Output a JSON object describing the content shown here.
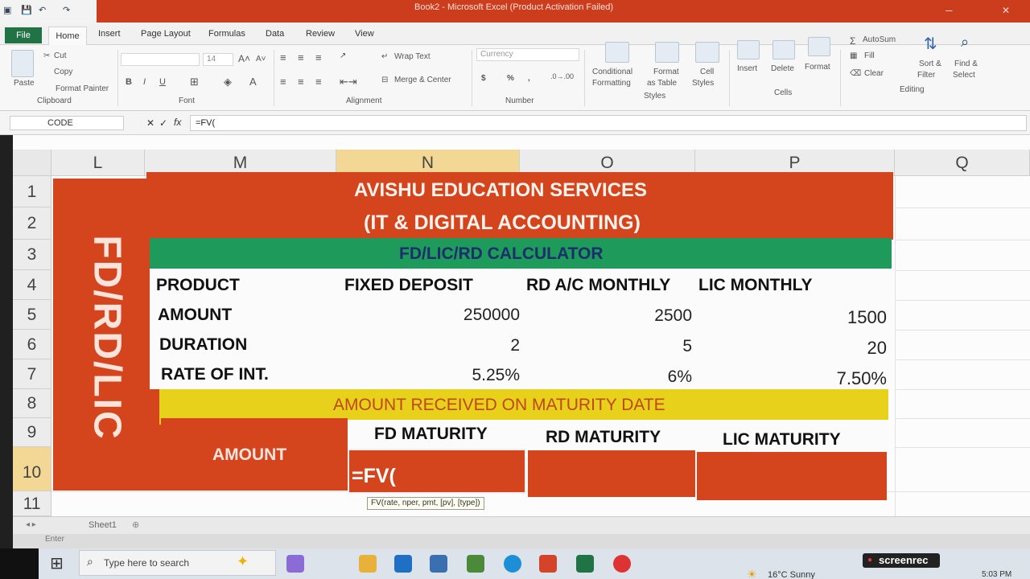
{
  "window": {
    "title": "Book2 - Microsoft Excel (Product Activation Failed)"
  },
  "ribbon": {
    "tabs": [
      "File",
      "Home",
      "Insert",
      "Page Layout",
      "Formulas",
      "Data",
      "Review",
      "View"
    ],
    "clipboard": {
      "cut": "Cut",
      "copy": "Copy",
      "paste": "Paste",
      "format_painter": "Format Painter",
      "group": "Clipboard"
    },
    "font": {
      "size": "14",
      "group": "Font"
    },
    "alignment": {
      "wrap_text": "Wrap Text",
      "merge_center": "Merge & Center",
      "group": "Alignment"
    },
    "number": {
      "format": "Currency",
      "group": "Number"
    },
    "styles": {
      "conditional": "Conditional",
      "formatting": "Formatting",
      "format_as": "Format",
      "as_table": "as Table",
      "cell": "Cell",
      "cell_styles": "Styles",
      "group": "Styles"
    },
    "cells": {
      "insert": "Insert",
      "delete": "Delete",
      "format": "Format",
      "group": "Cells"
    },
    "editing": {
      "autosum": "AutoSum",
      "fill": "Fill",
      "clear": "Clear",
      "sort": "Sort &",
      "filter": "Filter",
      "find": "Find &",
      "select": "Select",
      "group": "Editing"
    }
  },
  "formula_bar": {
    "name_box": "CODE",
    "formula": "=FV("
  },
  "columns": [
    "L",
    "M",
    "N",
    "O",
    "P",
    "Q"
  ],
  "rows": [
    "1",
    "2",
    "3",
    "4",
    "5",
    "6",
    "7",
    "8",
    "9",
    "10",
    "11"
  ],
  "sheet": {
    "side_label": "FD/RD/LIC",
    "header1": "AVISHU EDUCATION SERVICES",
    "header2": "(IT & DIGITAL ACCOUNTING)",
    "calc_title": "FD/LIC/RD CALCULATOR",
    "product_label": "PRODUCT",
    "product_fd": "FIXED DEPOSIT",
    "product_rd": "RD A/C MONTHLY",
    "product_lic": "LIC MONTHLY",
    "amount_label": "AMOUNT",
    "amount_fd": "250000",
    "amount_rd": "2500",
    "amount_lic": "1500",
    "duration_label": "DURATION",
    "duration_fd": "2",
    "duration_rd": "5",
    "duration_lic": "20",
    "rate_label": "RATE OF INT.",
    "rate_fd": "5.25%",
    "rate_rd": "6%",
    "rate_lic": "7.50%",
    "maturity_banner": "AMOUNT RECEIVED ON MATURITY DATE",
    "fd_maturity": "FD MATURITY",
    "rd_maturity": "RD MATURITY",
    "lic_maturity": "LIC MATURITY",
    "result_label": "AMOUNT",
    "edit_cell": "=FV(",
    "tooltip": "FV(rate, nper, pmt, [pv], [type])"
  },
  "sheet_tab": "Sheet1",
  "status": "Enter",
  "taskbar": {
    "search_placeholder": "Type here to search",
    "recorder": "screenrec",
    "weather": "16°C  Sunny",
    "time": "5:03 PM"
  },
  "colors": {
    "orange_red": "#d4441d",
    "green": "#1e9a5a",
    "yellow": "#e8d11a",
    "navy_text": "#1b2f6b",
    "excel_green": "#217346"
  }
}
